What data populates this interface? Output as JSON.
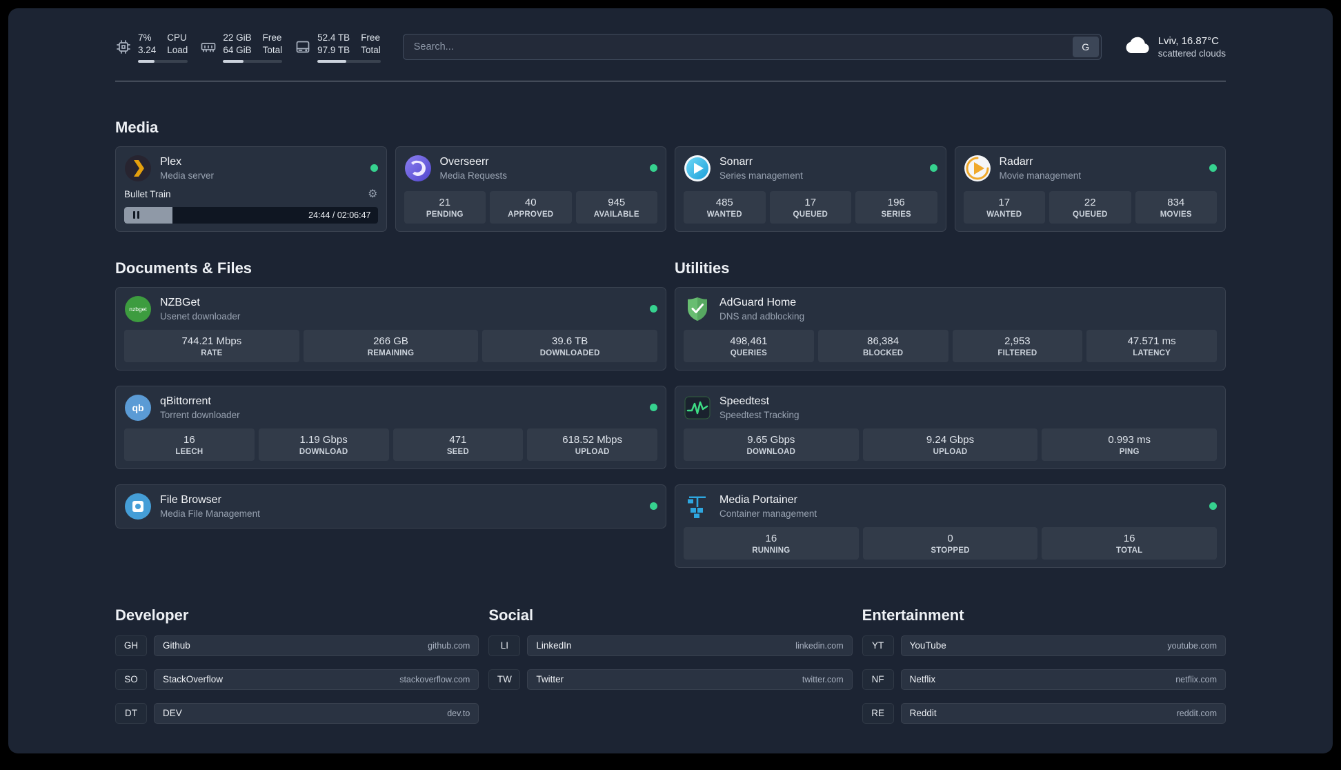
{
  "icons": {
    "gear": "⚙"
  },
  "topbar": {
    "resources": [
      {
        "icon": "cpu-icon",
        "value_top": "7%",
        "value_bottom": "3.24",
        "label_top": "CPU",
        "label_bottom": "Load",
        "progress_pct": 33
      },
      {
        "icon": "memory-icon",
        "value_top": "22 GiB",
        "value_bottom": "64 GiB",
        "label_top": "Free",
        "label_bottom": "Total",
        "progress_pct": 35
      },
      {
        "icon": "disk-icon",
        "value_top": "52.4 TB",
        "value_bottom": "97.9 TB",
        "label_top": "Free",
        "label_bottom": "Total",
        "progress_pct": 46
      }
    ],
    "search": {
      "placeholder": "Search...",
      "provider_label": "G"
    },
    "weather": {
      "location": "Lviv, 16.87°C",
      "condition": "scattered clouds"
    }
  },
  "sections": {
    "media": {
      "title": "Media",
      "plex": {
        "name": "Plex",
        "description": "Media server",
        "status": "online",
        "now_playing": {
          "title": "Bullet Train",
          "time": "24:44 / 02:06:47",
          "progress_pct": 19
        }
      },
      "overseerr": {
        "name": "Overseerr",
        "description": "Media Requests",
        "status": "online",
        "stats": [
          {
            "value": "21",
            "label": "PENDING"
          },
          {
            "value": "40",
            "label": "APPROVED"
          },
          {
            "value": "945",
            "label": "AVAILABLE"
          }
        ]
      },
      "sonarr": {
        "name": "Sonarr",
        "description": "Series management",
        "status": "online",
        "stats": [
          {
            "value": "485",
            "label": "WANTED"
          },
          {
            "value": "17",
            "label": "QUEUED"
          },
          {
            "value": "196",
            "label": "SERIES"
          }
        ]
      },
      "radarr": {
        "name": "Radarr",
        "description": "Movie management",
        "status": "online",
        "stats": [
          {
            "value": "17",
            "label": "WANTED"
          },
          {
            "value": "22",
            "label": "QUEUED"
          },
          {
            "value": "834",
            "label": "MOVIES"
          }
        ]
      }
    },
    "documents": {
      "title": "Documents & Files",
      "nzbget": {
        "name": "NZBGet",
        "description": "Usenet downloader",
        "status": "online",
        "icon_text": "nzbget",
        "stats": [
          {
            "value": "744.21 Mbps",
            "label": "RATE"
          },
          {
            "value": "266 GB",
            "label": "REMAINING"
          },
          {
            "value": "39.6 TB",
            "label": "DOWNLOADED"
          }
        ]
      },
      "qbittorrent": {
        "name": "qBittorrent",
        "description": "Torrent downloader",
        "status": "online",
        "icon_text": "qb",
        "stats": [
          {
            "value": "16",
            "label": "LEECH"
          },
          {
            "value": "1.19 Gbps",
            "label": "DOWNLOAD"
          },
          {
            "value": "471",
            "label": "SEED"
          },
          {
            "value": "618.52 Mbps",
            "label": "UPLOAD"
          }
        ]
      },
      "filebrowser": {
        "name": "File Browser",
        "description": "Media File Management",
        "status": "online"
      }
    },
    "utilities": {
      "title": "Utilities",
      "adguard": {
        "name": "AdGuard Home",
        "description": "DNS and adblocking",
        "stats": [
          {
            "value": "498,461",
            "label": "QUERIES"
          },
          {
            "value": "86,384",
            "label": "BLOCKED"
          },
          {
            "value": "2,953",
            "label": "FILTERED"
          },
          {
            "value": "47.571 ms",
            "label": "LATENCY"
          }
        ]
      },
      "speedtest": {
        "name": "Speedtest",
        "description": "Speedtest Tracking",
        "stats": [
          {
            "value": "9.65 Gbps",
            "label": "DOWNLOAD"
          },
          {
            "value": "9.24 Gbps",
            "label": "UPLOAD"
          },
          {
            "value": "0.993 ms",
            "label": "PING"
          }
        ]
      },
      "portainer": {
        "name": "Media Portainer",
        "description": "Container management",
        "status": "online",
        "stats": [
          {
            "value": "16",
            "label": "RUNNING"
          },
          {
            "value": "0",
            "label": "STOPPED"
          },
          {
            "value": "16",
            "label": "TOTAL"
          }
        ]
      }
    },
    "bookmarks": [
      {
        "title": "Developer",
        "items": [
          {
            "abbr": "GH",
            "name": "Github",
            "url": "github.com"
          },
          {
            "abbr": "SO",
            "name": "StackOverflow",
            "url": "stackoverflow.com"
          },
          {
            "abbr": "DT",
            "name": "DEV",
            "url": "dev.to"
          }
        ]
      },
      {
        "title": "Social",
        "items": [
          {
            "abbr": "LI",
            "name": "LinkedIn",
            "url": "linkedin.com"
          },
          {
            "abbr": "TW",
            "name": "Twitter",
            "url": "twitter.com"
          }
        ]
      },
      {
        "title": "Entertainment",
        "items": [
          {
            "abbr": "YT",
            "name": "YouTube",
            "url": "youtube.com"
          },
          {
            "abbr": "NF",
            "name": "Netflix",
            "url": "netflix.com"
          },
          {
            "abbr": "RE",
            "name": "Reddit",
            "url": "reddit.com"
          }
        ]
      }
    ]
  },
  "colors": {
    "status_online": "#36d28f",
    "accent_green": "#3ddc84",
    "page_bg": "#1c2433",
    "card_bg": "#27303f"
  }
}
